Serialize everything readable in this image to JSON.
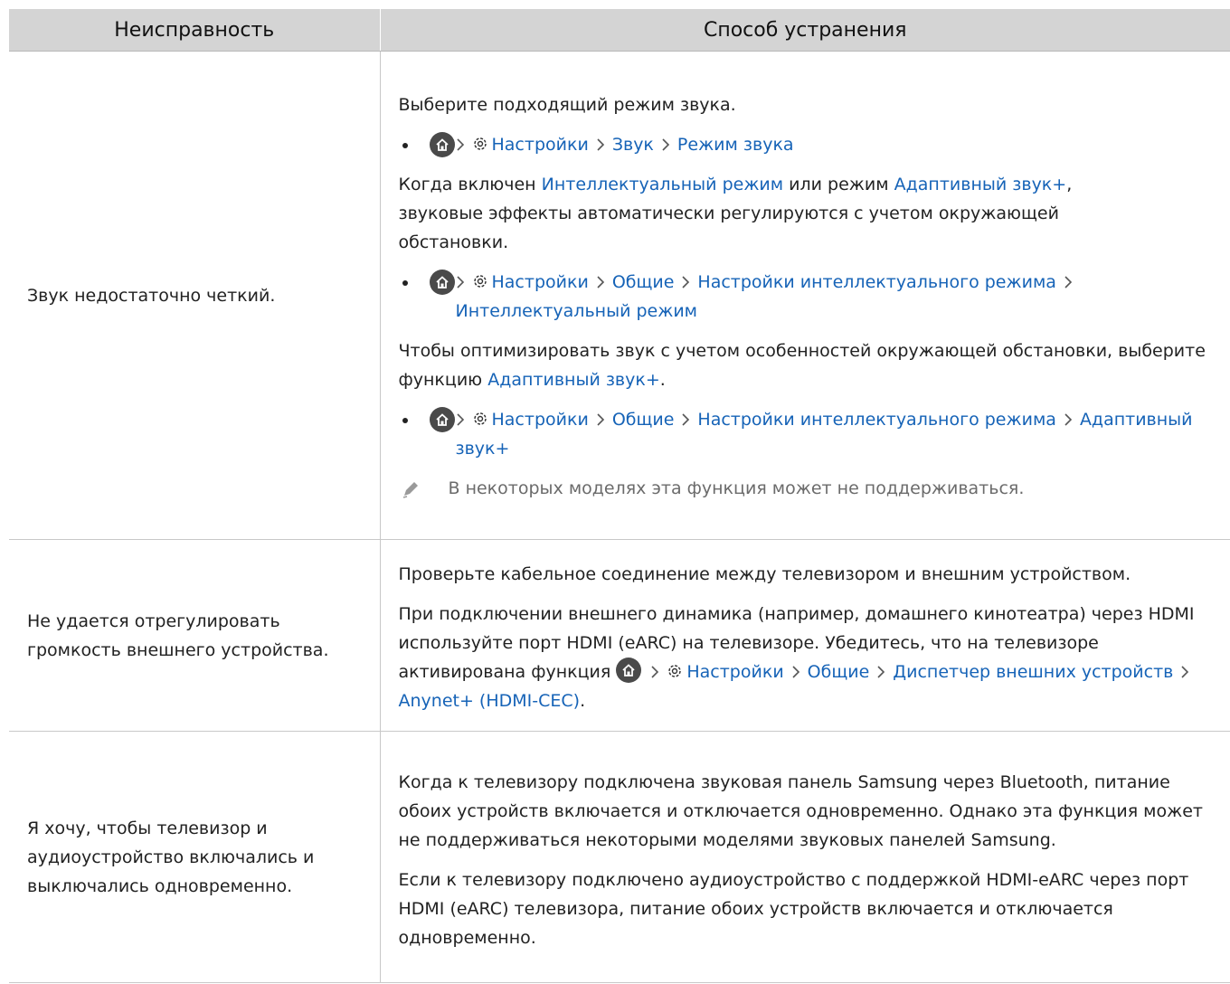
{
  "header": {
    "problem_col": "Неисправность",
    "solution_col": "Способ устранения"
  },
  "rows": [
    {
      "problem": "Звук недостаточно четкий.",
      "p1": "Выберите подходящий режим звука.",
      "path1": {
        "settings": "Настройки",
        "sound": "Звук",
        "sound_mode": "Режим звука"
      },
      "p2_a": "Когда включен ",
      "p2_link1": "Интеллектуальный режим",
      "p2_b": " или режим ",
      "p2_link2": "Адаптивный звук+",
      "p2_c": ", звуковые эффекты автоматически регулируются с учетом окружающей обстановки.",
      "path2": {
        "settings": "Настройки",
        "general": "Общие",
        "intel_settings": "Настройки интеллектуального режима",
        "intel_mode": "Интеллектуальный режим"
      },
      "p3_a": "Чтобы оптимизировать звук с учетом особенностей окружающей обстановки, выберите функцию ",
      "p3_link": "Адаптивный звук+",
      "p3_b": ".",
      "path3": {
        "settings": "Настройки",
        "general": "Общие",
        "intel_settings": "Настройки интеллектуального режима",
        "adaptive": "Адаптивный звук+"
      },
      "note": "В некоторых моделях эта функция может не поддерживаться."
    },
    {
      "problem": "Не удается отрегулировать громкость внешнего устройства.",
      "p1": "Проверьте кабельное соединение между телевизором и внешним устройством.",
      "p2_a": "При подключении внешнего динамика (например, домашнего кинотеатра) через HDMI используйте порт HDMI (eARC) на телевизоре. Убедитесь, что на телевизоре активирована функция ",
      "path": {
        "settings": "Настройки",
        "general": "Общие",
        "device_manager": "Диспетчер внешних устройств",
        "anynet": "Anynet+ (HDMI-CEC)"
      },
      "p2_end": "."
    },
    {
      "problem": "Я хочу, чтобы телевизор и аудиоустройство включались и выключались одновременно.",
      "p1": "Когда к телевизору подключена звуковая панель Samsung через Bluetooth, питание обоих устройств включается и отключается одновременно. Однако эта функция может не поддерживаться некоторыми моделями звуковых панелей Samsung.",
      "p2": "Если к телевизору подключено аудиоустройство с поддержкой HDMI-eARC через порт HDMI (eARC) телевизора, питание обоих устройств включается и отключается одновременно."
    }
  ]
}
